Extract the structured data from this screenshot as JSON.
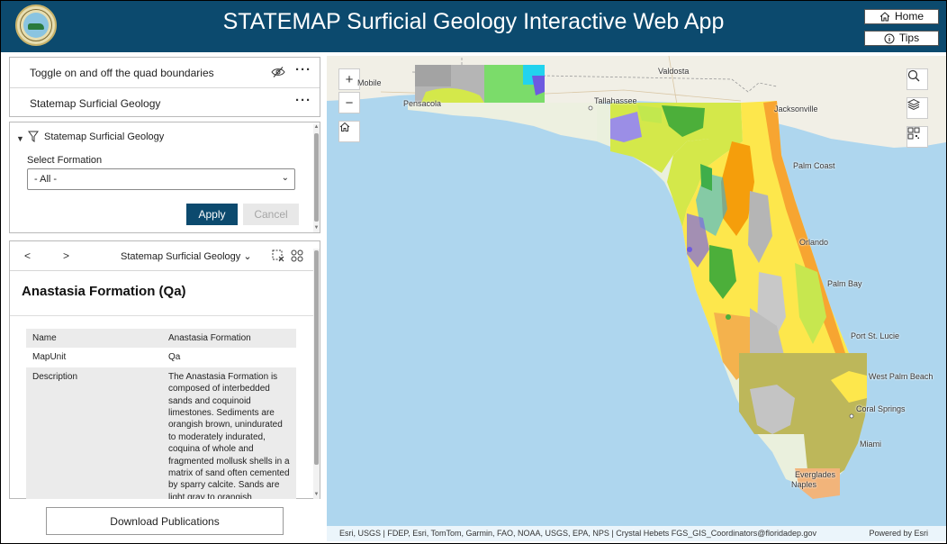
{
  "header": {
    "title": "STATEMAP Surficial Geology Interactive Web App",
    "home_label": "Home",
    "tips_label": "Tips"
  },
  "layer_list": {
    "items": [
      {
        "label": "Toggle on and off the quad boundaries"
      },
      {
        "label": "Statemap Surficial Geology"
      }
    ],
    "more_label": "···"
  },
  "filter": {
    "title": "Statemap Surficial Geology",
    "select_label": "Select Formation",
    "selected_value": "- All -",
    "apply_label": "Apply",
    "cancel_label": "Cancel"
  },
  "info": {
    "prev_label": "<",
    "next_label": ">",
    "layer_name": "Statemap Surficial Geology",
    "feature_title": "Anastasia Formation (Qa)",
    "attributes": [
      {
        "key": "Name",
        "value": "Anastasia Formation"
      },
      {
        "key": "MapUnit",
        "value": "Qa"
      },
      {
        "key": "Description",
        "value": "The Anastasia Formation is composed of interbedded sands and coquinoid limestones. Sediments are orangish brown, unindurated to moderately indurated, coquina of whole and fragmented mollusk shells in a matrix of sand often cemented by sparry calcite. Sands are light gray to orangish"
      }
    ]
  },
  "download_label": "Download Publications",
  "map": {
    "cities": [
      "Mobile",
      "Valdosta",
      "Pensacola",
      "Tallahassee",
      "Jacksonville",
      "Palm Coast",
      "Orlando",
      "Palm Bay",
      "Port St. Lucie",
      "West Palm Beach",
      "Coral Springs",
      "Miami",
      "Everglades",
      "Naples"
    ],
    "attribution": "Esri, USGS | FDEP, Esri, TomTom, Garmin, FAO, NOAA, USGS, EPA, NPS | Crystal Hebets FGS_GIS_Coordinators@floridadep.gov",
    "powered_by": "Powered by Esri"
  },
  "colors": {
    "header": "#0c4a6e",
    "accent": "#0c4a6e",
    "water": "#aed6ee",
    "land": "#f1efe6"
  }
}
